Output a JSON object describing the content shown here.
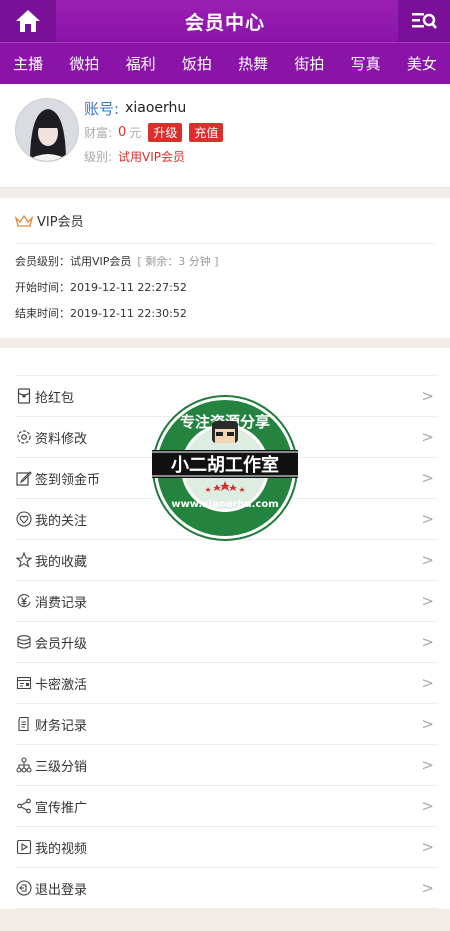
{
  "header": {
    "title": "会员中心"
  },
  "nav": [
    "主播",
    "微拍",
    "福利",
    "饭拍",
    "热舞",
    "街拍",
    "写真",
    "美女"
  ],
  "profile": {
    "account_label": "账号:",
    "account": "xiaoerhu",
    "wealth_label": "财富:",
    "wealth": "0",
    "wealth_unit": "元",
    "upgrade_label": "升级",
    "recharge_label": "充值",
    "level_label": "级别:",
    "level": "试用VIP会员"
  },
  "vip": {
    "title": "VIP会员",
    "level_line": "会员级别：试用VIP会员",
    "remaining": "[ 剩余：3 分钟 ]",
    "start_line": "开始时间：2019-12-11 22:27:52",
    "end_line": "结束时间：2019-12-11 22:30:52"
  },
  "menu": [
    {
      "label": "抢红包",
      "icon": "redpacket-icon"
    },
    {
      "label": "资料修改",
      "icon": "gear-icon"
    },
    {
      "label": "签到领金币",
      "icon": "edit-icon"
    },
    {
      "label": "我的关注",
      "icon": "heart-icon"
    },
    {
      "label": "我的收藏",
      "icon": "star-icon"
    },
    {
      "label": "消费记录",
      "icon": "yen-icon"
    },
    {
      "label": "会员升级",
      "icon": "database-icon"
    },
    {
      "label": "卡密激活",
      "icon": "card-icon"
    },
    {
      "label": "财务记录",
      "icon": "document-icon"
    },
    {
      "label": "三级分销",
      "icon": "hierarchy-icon"
    },
    {
      "label": "宣传推广",
      "icon": "share-icon"
    },
    {
      "label": "我的视频",
      "icon": "video-icon"
    },
    {
      "label": "退出登录",
      "icon": "logout-icon"
    }
  ],
  "arrow": ">",
  "watermark": {
    "top_text": "专注资源分享",
    "brand": "小二胡工作室",
    "url": "www.xiaoerhu.com"
  },
  "colors": {
    "brand_purple": "#8a14a8",
    "accent_red": "#d9302c",
    "link_blue": "#3b78c9"
  }
}
